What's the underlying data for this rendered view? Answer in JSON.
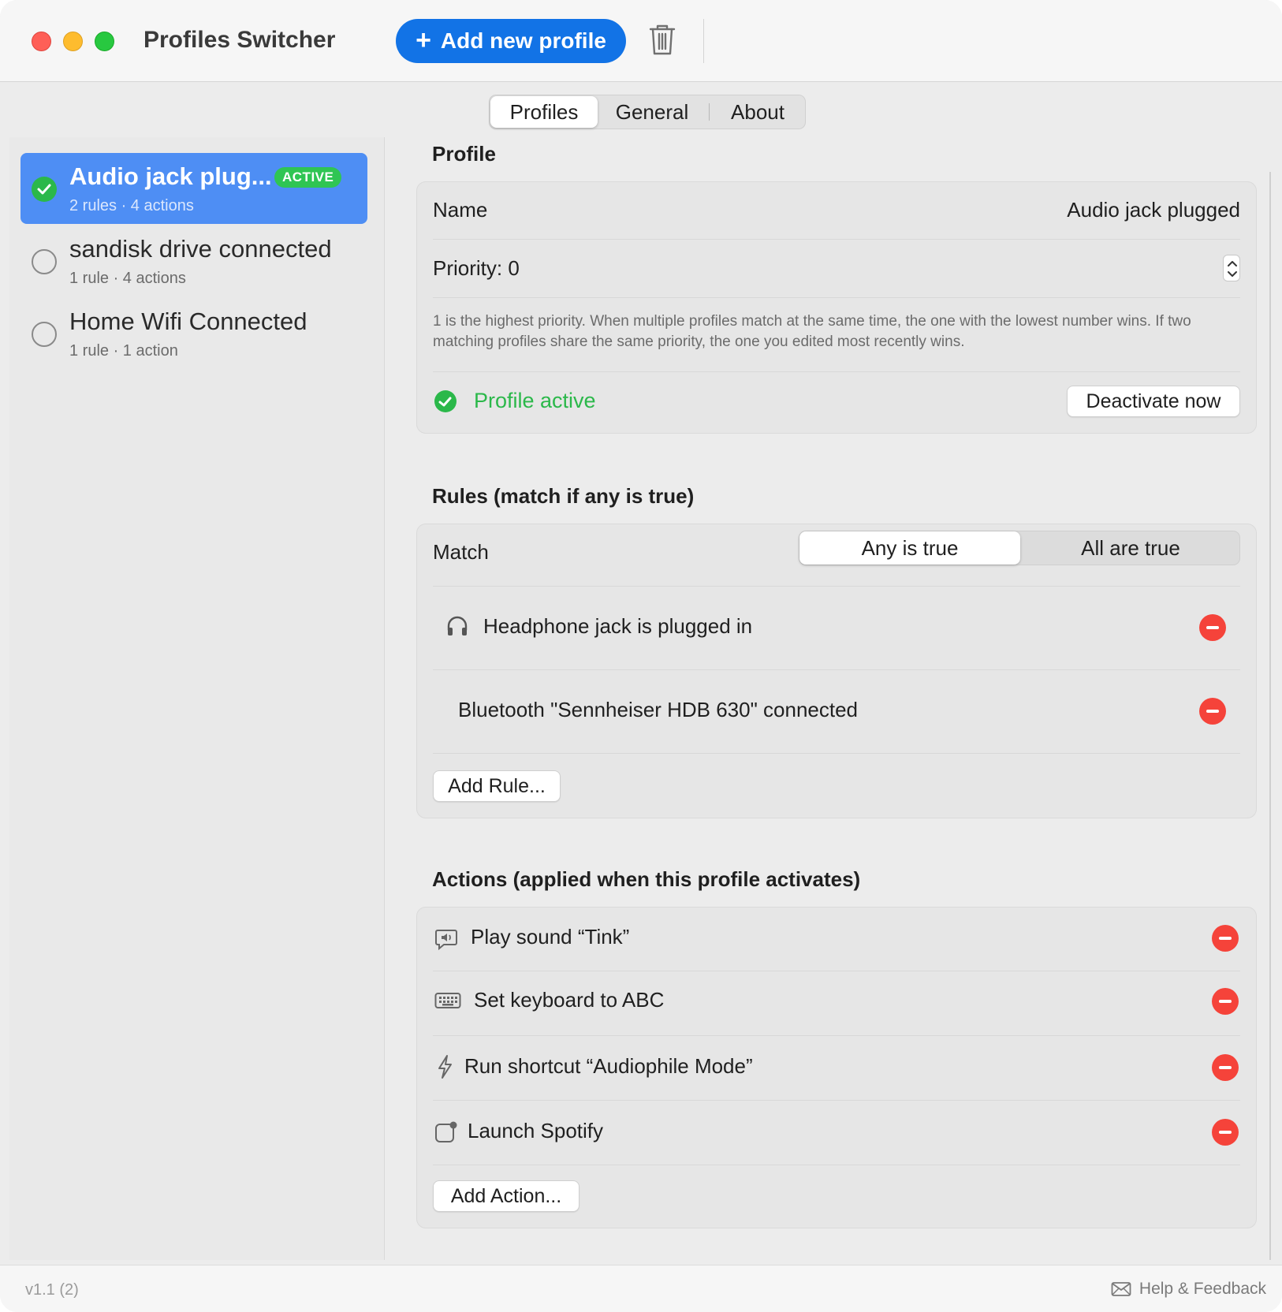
{
  "window": {
    "title": "Profiles Switcher"
  },
  "toolbar": {
    "add_profile_label": "Add new profile"
  },
  "tabs": [
    {
      "label": "Profiles",
      "selected": true
    },
    {
      "label": "General",
      "selected": false
    },
    {
      "label": "About",
      "selected": false
    }
  ],
  "sidebar": {
    "profiles": [
      {
        "name": "Audio jack plug...",
        "summary": "2 rules · 4 actions",
        "badge": "ACTIVE",
        "selected": true
      },
      {
        "name": "sandisk drive connected",
        "summary": "1 rule · 4 actions",
        "selected": false
      },
      {
        "name": "Home Wifi Connected",
        "summary": "1 rule · 1 action",
        "selected": false
      }
    ]
  },
  "profile": {
    "section_title": "Profile",
    "name_label": "Name",
    "name_value": "Audio jack plugged",
    "priority_label": "Priority: 0",
    "priority_hint": "1 is the highest priority. When multiple profiles match at the same time, the one with the lowest number wins. If two matching profiles share the same priority, the one you edited most recently wins.",
    "status_text": "Profile active",
    "deactivate_label": "Deactivate now"
  },
  "rules": {
    "section_title": "Rules (match if any is true)",
    "match_label": "Match",
    "match_options": [
      "Any is true",
      "All are true"
    ],
    "match_selected": "Any is true",
    "items": [
      {
        "text": "Headphone jack is plugged in",
        "icon": "headphones-icon"
      },
      {
        "text": "Bluetooth \"Sennheiser HDB 630\" connected",
        "icon": ""
      }
    ],
    "add_label": "Add Rule..."
  },
  "actions": {
    "section_title": "Actions (applied when this profile activates)",
    "items": [
      {
        "text": "Play sound “Tink”",
        "icon": "speaker-bubble-icon"
      },
      {
        "text": "Set keyboard to ABC",
        "icon": "keyboard-icon"
      },
      {
        "text": "Run shortcut “Audiophile Mode”",
        "icon": "bolt-icon"
      },
      {
        "text": "Launch Spotify",
        "icon": "app-launch-icon"
      }
    ],
    "add_label": "Add Action..."
  },
  "footer": {
    "version": "v1.1 (2)",
    "help_label": "Help & Feedback"
  },
  "colors": {
    "accent": "#1273e6",
    "selection": "#4e8ef4",
    "active_green": "#2bb84a",
    "remove_red": "#f5433a"
  }
}
